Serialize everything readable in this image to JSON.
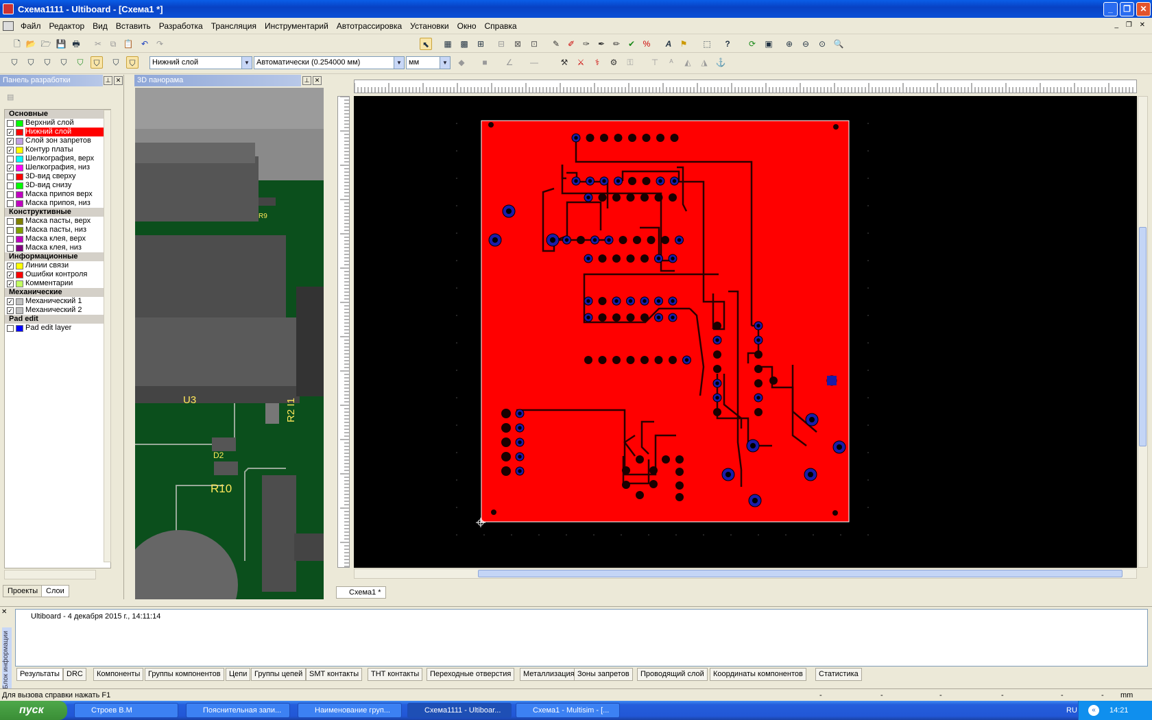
{
  "window": {
    "title": "Схема1111 - Ultiboard - [Схема1 *]"
  },
  "menu": [
    "Файл",
    "Редактор",
    "Вид",
    "Вставить",
    "Разработка",
    "Трансляция",
    "Инструментарий",
    "Автотрассировка",
    "Установки",
    "Окно",
    "Справка"
  ],
  "toolbar2": {
    "layer": "Нижний слой",
    "width": "Автоматически (0.254000 мм)",
    "units": "мм"
  },
  "design_panel": {
    "title": "Панель разработки",
    "groups": [
      {
        "name": "Основные",
        "layers": [
          {
            "label": "Верхний слой",
            "checked": false,
            "color": "#00ff00"
          },
          {
            "label": "Нижний слой",
            "checked": true,
            "color": "#ff0000",
            "selected": true
          },
          {
            "label": "Слой зон запретов",
            "checked": true,
            "color": "#c0a0e0"
          },
          {
            "label": "Контур платы",
            "checked": true,
            "color": "#ffff00"
          },
          {
            "label": "Шелкография, верх",
            "checked": false,
            "color": "#00ffff"
          },
          {
            "label": "Шелкография, низ",
            "checked": true,
            "color": "#ff00ff"
          },
          {
            "label": "3D-вид сверху",
            "checked": false,
            "color": "#ff0000"
          },
          {
            "label": "3D-вид снизу",
            "checked": false,
            "color": "#00ff00"
          },
          {
            "label": "Маска припоя верх",
            "checked": false,
            "color": "#c000c0"
          },
          {
            "label": "Маска припоя, низ",
            "checked": false,
            "color": "#c000c0"
          }
        ]
      },
      {
        "name": "Конструктивные",
        "layers": [
          {
            "label": "Маска пасты, верх",
            "checked": false,
            "color": "#808000"
          },
          {
            "label": "Маска пасты, низ",
            "checked": false,
            "color": "#80a000"
          },
          {
            "label": "Маска клея, верх",
            "checked": false,
            "color": "#c000c0"
          },
          {
            "label": "Маска клея, низ",
            "checked": false,
            "color": "#800080"
          }
        ]
      },
      {
        "name": "Информационные",
        "layers": [
          {
            "label": "Линии связи",
            "checked": true,
            "color": "#ffff00"
          },
          {
            "label": "Ошибки контроля",
            "checked": true,
            "color": "#ff0000"
          },
          {
            "label": "Комментарии",
            "checked": true,
            "color": "#c0ff60"
          }
        ]
      },
      {
        "name": "Механические",
        "layers": [
          {
            "label": "Механический 1",
            "checked": true,
            "color": "#c0c0c0"
          },
          {
            "label": "Механический 2",
            "checked": true,
            "color": "#c0c0c0"
          }
        ]
      },
      {
        "name": "Pad edit",
        "layers": [
          {
            "label": "Pad edit layer",
            "checked": false,
            "color": "#0000ff"
          }
        ]
      }
    ],
    "tabs": [
      "Проекты",
      "Слои"
    ]
  },
  "panel3d": {
    "title": "3D панорама",
    "labels": [
      "R9",
      "U3",
      "R2 I1",
      "D2",
      "R10"
    ]
  },
  "document_tab": "Схема1 *",
  "output": {
    "side_label": "Блок информации",
    "log": "Ultiboard  -  4 декабря 2015 г., 14:11:14",
    "tabs": [
      "Результаты",
      "DRC",
      "Компоненты",
      "Группы компонентов",
      "Цепи",
      "Группы цепей",
      "SMT контакты",
      "THT контакты",
      "Переходные отверстия",
      "Металлизация",
      "Зоны запретов",
      "Проводящий слой",
      "Координаты компонентов",
      "Статистика"
    ]
  },
  "status": {
    "text": "Для вызова справки нажать F1",
    "dashes": [
      "-",
      "-",
      "-",
      "-",
      "-",
      "-",
      "-"
    ],
    "units": "mm"
  },
  "taskbar": {
    "start": "пуск",
    "tasks": [
      "Строев В.М",
      "Пояснительная запи...",
      "Наименование груп...",
      "Схема1111 - Ultiboar...",
      "Схема1 - Multisim - [..."
    ],
    "lang": "RU",
    "clock": "14:21"
  },
  "colors": {
    "board": "#ff0000",
    "pads": "#00008b",
    "trace": "#1a0000"
  }
}
